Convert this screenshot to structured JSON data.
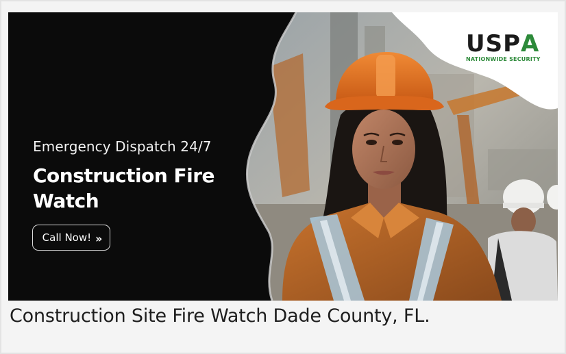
{
  "banner": {
    "kicker": "Emergency Dispatch 24/7",
    "headline": "Construction Fire Watch",
    "cta_label": "Call Now!",
    "cta_icon": "chevron-double-right-icon",
    "image_description_icon": "construction-worker-photo"
  },
  "logo": {
    "wordmark_main": "USP",
    "wordmark_accent": "A",
    "tagline": "NATIONWIDE SECURITY"
  },
  "caption": {
    "text": "Construction Site Fire Watch Dade County, FL."
  },
  "colors": {
    "banner_bg": "#0b0b0b",
    "logo_green": "#2d8a3a",
    "hardhat_orange": "#e0741f"
  }
}
